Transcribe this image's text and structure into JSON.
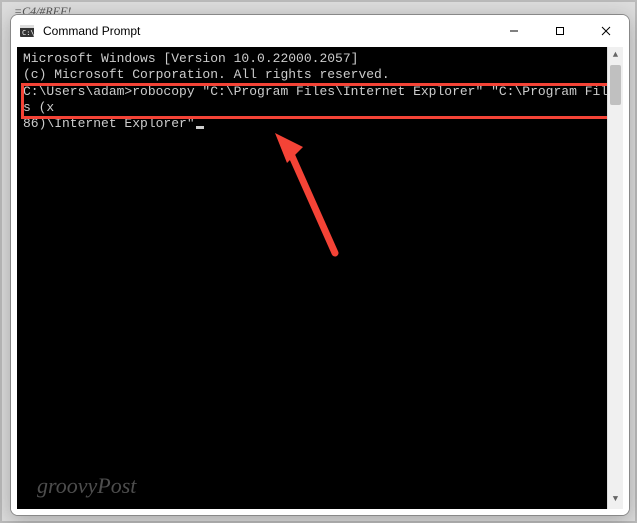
{
  "crumb": "=C4/#REF!",
  "window": {
    "title": "Command Prompt"
  },
  "terminal": {
    "line1": "Microsoft Windows [Version 10.0.22000.2057]",
    "line2": "(c) Microsoft Corporation. All rights reserved.",
    "blank": "",
    "prompt_line_a": "C:\\Users\\adam>robocopy \"C:\\Program Files\\Internet Explorer\" \"C:\\Program Files (x",
    "prompt_line_b": "86)\\Internet Explorer\""
  },
  "watermark": "groovyPost"
}
